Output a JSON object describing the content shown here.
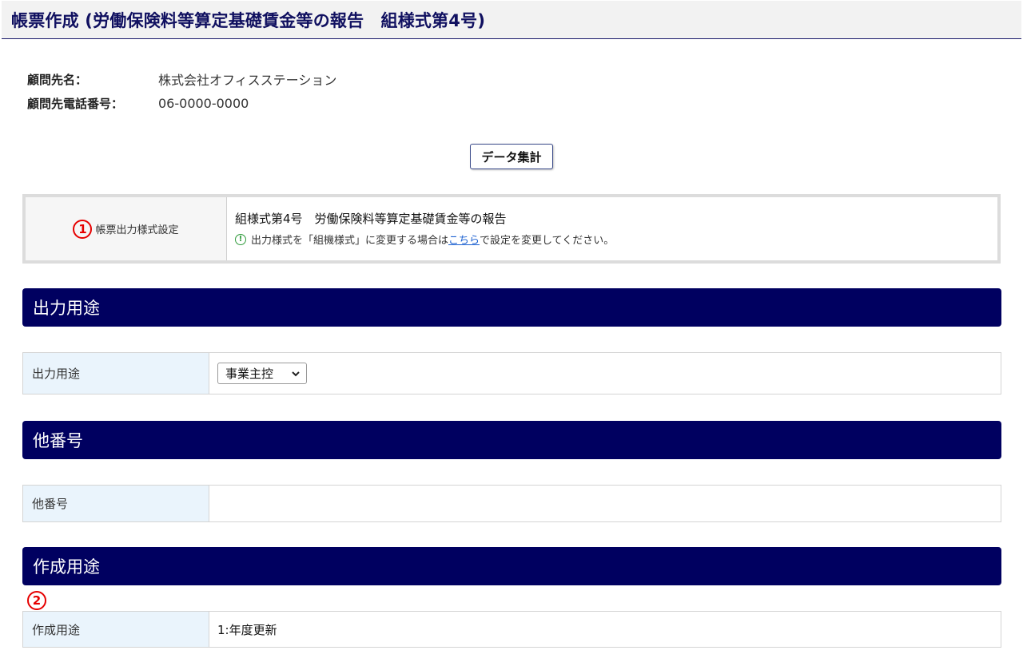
{
  "header": {
    "title": "帳票作成 (労働保険料等算定基礎賃金等の報告　組様式第4号)"
  },
  "client": {
    "name_label": "顧問先名：",
    "name_value": "株式会社オフィスステーション",
    "phone_label": "顧問先電話番号：",
    "phone_value": "06-0000-0000"
  },
  "aggregate_button_label": "データ集計",
  "format_setting": {
    "marker": "1",
    "label": "帳票出力様式設定",
    "value": "組様式第4号　労働保険料等算定基礎賃金等の報告",
    "note_prefix": "出力様式を「組機様式」に変更する場合は",
    "note_link": "こちら",
    "note_suffix": "で設定を変更してください。"
  },
  "sections": {
    "output_purpose": {
      "title": "出力用途",
      "field_label": "出力用途",
      "selected_option": "事業主控"
    },
    "other_number": {
      "title": "他番号",
      "field_label": "他番号",
      "value": ""
    },
    "creation_purpose": {
      "title": "作成用途",
      "marker": "2",
      "field_label": "作成用途",
      "value": "1:年度更新"
    }
  },
  "icons": {
    "note": "info-circle-icon",
    "select": "chevron-down-icon"
  },
  "colors": {
    "section_header_bg": "#000060",
    "label_cell_bg": "#eaf4fc",
    "marker_red": "#e60000",
    "link_blue": "#1a5fd0"
  }
}
